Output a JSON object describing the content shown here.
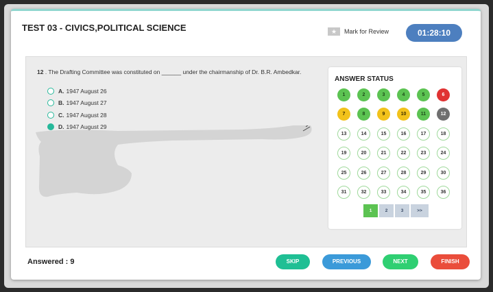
{
  "header": {
    "test_title": "TEST 03 - CIVICS,POLITICAL SCIENCE",
    "mark_review_label": "Mark for Review",
    "timer": "01:28:10"
  },
  "question": {
    "number": "12",
    "text": " . The Drafting Committee was constituted on ______ under the chairmanship of Dr. B.R. Ambedkar.",
    "options": [
      {
        "letter": "A.",
        "text": "1947 August 26",
        "selected": false
      },
      {
        "letter": "B.",
        "text": "1947 August 27",
        "selected": false
      },
      {
        "letter": "C.",
        "text": "1947 August 28",
        "selected": false
      },
      {
        "letter": "D.",
        "text": "1947 August 29",
        "selected": true
      }
    ]
  },
  "answer_status": {
    "title": "ANSWER STATUS",
    "items": [
      {
        "n": "1",
        "state": "green"
      },
      {
        "n": "2",
        "state": "green"
      },
      {
        "n": "3",
        "state": "green"
      },
      {
        "n": "4",
        "state": "green"
      },
      {
        "n": "5",
        "state": "green"
      },
      {
        "n": "6",
        "state": "red"
      },
      {
        "n": "7",
        "state": "yellow"
      },
      {
        "n": "8",
        "state": "green"
      },
      {
        "n": "9",
        "state": "yellow"
      },
      {
        "n": "10",
        "state": "yellow"
      },
      {
        "n": "11",
        "state": "green"
      },
      {
        "n": "12",
        "state": "gray"
      },
      {
        "n": "13",
        "state": "empty"
      },
      {
        "n": "14",
        "state": "empty"
      },
      {
        "n": "15",
        "state": "empty"
      },
      {
        "n": "16",
        "state": "empty"
      },
      {
        "n": "17",
        "state": "empty"
      },
      {
        "n": "18",
        "state": "empty"
      },
      {
        "n": "19",
        "state": "empty"
      },
      {
        "n": "20",
        "state": "empty"
      },
      {
        "n": "21",
        "state": "empty"
      },
      {
        "n": "22",
        "state": "empty"
      },
      {
        "n": "23",
        "state": "empty"
      },
      {
        "n": "24",
        "state": "empty"
      },
      {
        "n": "25",
        "state": "empty"
      },
      {
        "n": "26",
        "state": "empty"
      },
      {
        "n": "27",
        "state": "empty"
      },
      {
        "n": "28",
        "state": "empty"
      },
      {
        "n": "29",
        "state": "empty"
      },
      {
        "n": "30",
        "state": "empty"
      },
      {
        "n": "31",
        "state": "empty"
      },
      {
        "n": "32",
        "state": "empty"
      },
      {
        "n": "33",
        "state": "empty"
      },
      {
        "n": "34",
        "state": "empty"
      },
      {
        "n": "35",
        "state": "empty"
      },
      {
        "n": "36",
        "state": "empty"
      }
    ],
    "pages": [
      {
        "label": "1",
        "active": true
      },
      {
        "label": "2",
        "active": false
      },
      {
        "label": "3",
        "active": false
      },
      {
        "label": ">>",
        "active": false
      }
    ]
  },
  "footer": {
    "answered_label": "Answered : 9",
    "skip_label": "SKIP",
    "previous_label": "PREVIOUS",
    "next_label": "NEXT",
    "finish_label": "FINISH"
  },
  "colors": {
    "accent_teal": "#26b89a",
    "timer_blue": "#4d7fbf",
    "status_green": "#5cc352",
    "status_yellow": "#f2c21b",
    "status_red": "#e03232",
    "status_gray": "#6f6f6f"
  },
  "icons": {
    "mark_review": "star-icon",
    "scribble": "scribble-overlay"
  }
}
